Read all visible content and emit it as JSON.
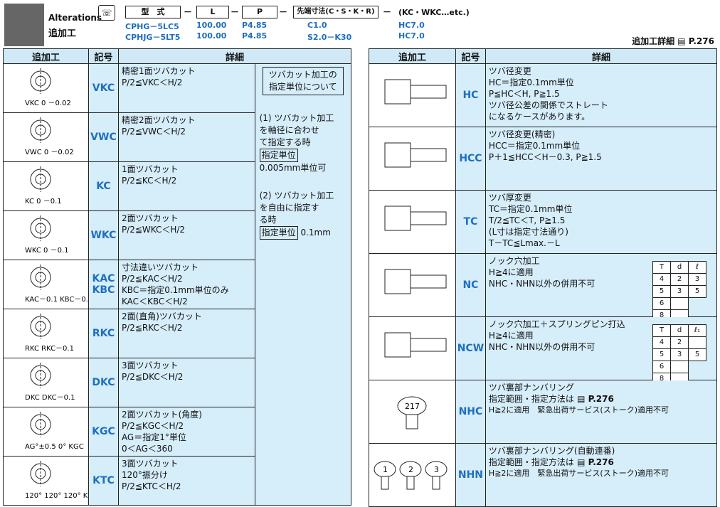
{
  "header": {
    "title_en": "Alterations",
    "title_jp": "追加工",
    "code_boxes": [
      "型　式",
      "L",
      "P",
      "先端寸法(C・S・K・R)"
    ],
    "suffix": "(KC・WKC…etc.)",
    "example1": [
      "CPHG－5LC5",
      "100.00",
      "P4.85",
      "C1.0",
      "HC7.0"
    ],
    "example2": [
      "CPHJG－5LT5",
      "100.00",
      "P4.85",
      "S2.0－K30",
      "HC7.0"
    ],
    "page_ref_label": "追加工詳細",
    "page_ref": "P.276"
  },
  "table_headers": [
    "追加工",
    "記号",
    "詳細"
  ],
  "left_rows": [
    {
      "diagram": "VKC  0\n－0.02",
      "symbol": "VKC",
      "lines": [
        "精密1面ツバカット",
        "P/2≦VKC＜H/2"
      ]
    },
    {
      "diagram": "VWC  0\n－0.02",
      "symbol": "VWC",
      "lines": [
        "精密2面ツバカット",
        "P/2≦VWC＜H/2"
      ]
    },
    {
      "diagram": "KC  0\n－0.1",
      "symbol": "KC",
      "lines": [
        "1面ツバカット",
        "P/2≦KC＜H/2"
      ]
    },
    {
      "diagram": "WKC  0\n－0.1",
      "symbol": "WKC",
      "lines": [
        "2面ツバカット",
        "P/2≦WKC＜H/2"
      ]
    },
    {
      "diagram": "KAC－0.1  KBC－0.1",
      "symbol": "KAC\nKBC",
      "lines": [
        "寸法違いツバカット",
        "P/2≦KAC＜H/2",
        "KBC＝指定0.1mm単位のみ",
        "KAC＜KBC＜H/2"
      ]
    },
    {
      "diagram": "RKC  RKC－0.1",
      "symbol": "RKC",
      "lines": [
        "2面(直角)ツバカット",
        "P/2≦RKC＜H/2"
      ]
    },
    {
      "diagram": "DKC  DKC－0.1",
      "symbol": "DKC",
      "lines": [
        "3面ツバカット",
        "P/2≦DKC＜H/2"
      ]
    },
    {
      "diagram": "AG°±0.5  0°  KGC",
      "symbol": "KGC",
      "lines": [
        "2面ツバカット(角度)",
        "P/2≦KGC＜H/2",
        "AG＝指定1°単位",
        "0＜AG＜360"
      ]
    },
    {
      "diagram": "120°  120°  120°  KTC－0.1",
      "symbol": "KTC",
      "lines": [
        "3面ツバカット",
        "120°振分け",
        "P/2≦KTC＜H/2"
      ]
    }
  ],
  "note": {
    "box": "ツバカット加工の\n指定単位について",
    "p1": "(1) ツバカット加工\nを軸径に合わせ\nて指定する時",
    "p1_label": "指定単位",
    "p1_value": "0.005mm単位可",
    "p2": "(2) ツバカット加工\nを自由に指定す\nる時",
    "p2_label": "指定単位",
    "p2_value": "0.1mm"
  },
  "right_rows": [
    {
      "symbol": "HC",
      "lines": [
        "ツバ径変更",
        "HC＝指定0.1mm単位",
        "P≦HC＜H, P≧1.5",
        "ツバ径公差の関係でストレート",
        "になるケースがあります。"
      ]
    },
    {
      "symbol": "HCC",
      "lines": [
        "ツバ径変更(精密)",
        "HCC＝指定0.1mm単位",
        "P＋1≦HCC＜H－0.3, P≧1.5"
      ]
    },
    {
      "symbol": "TC",
      "lines": [
        "ツバ厚変更",
        "TC＝指定0.1mm単位",
        "T/2≦TC＜T, P≧1.5",
        "(L寸は指定寸法通り)",
        "T－TC≦Lmax.－L"
      ]
    },
    {
      "symbol": "NC",
      "lines": [
        "ノック穴加工",
        "H≧4に適用",
        "NHC・NHN以外の併用不可"
      ],
      "mini": [
        [
          "T",
          "d",
          "ℓ"
        ],
        [
          "4",
          "2",
          "3"
        ],
        [
          "5",
          "3",
          "5"
        ],
        [
          "6",
          ""
        ],
        [
          "8",
          ""
        ]
      ]
    },
    {
      "symbol": "NCW",
      "lines": [
        "ノック穴加工＋スプリングピン打込",
        "H≧4に適用",
        "NHC・NHN以外の併用不可"
      ],
      "mini": [
        [
          "T",
          "d",
          "ℓ₁"
        ],
        [
          "4",
          "2",
          ""
        ],
        [
          "5",
          "3",
          "5"
        ],
        [
          "6",
          ""
        ],
        [
          "8",
          ""
        ]
      ]
    },
    {
      "symbol": "NHC",
      "lines": [
        "ツバ裏部ナンバリング",
        "指定範囲・指定方法は",
        "H≧2に適用　緊急出荷サービス(ストーク)適用不可"
      ],
      "ref": "P.276",
      "diagram": "217"
    },
    {
      "symbol": "NHN",
      "lines": [
        "ツバ裏部ナンバリング(自動連番)",
        "指定範囲・指定方法は",
        "H≧2に適用　緊急出荷サービス(ストーク)適用不可"
      ],
      "ref": "P.276",
      "diagram": [
        "1",
        "2",
        "3"
      ]
    }
  ]
}
